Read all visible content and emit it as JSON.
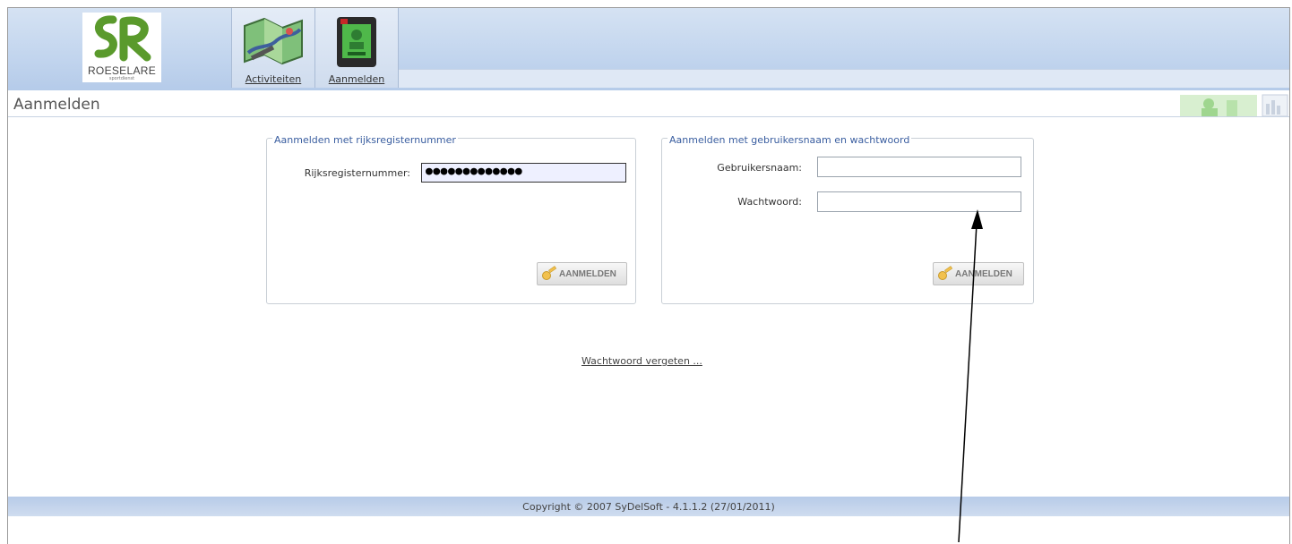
{
  "logo": {
    "text": "ROESELARE",
    "subtext": "sportdienst"
  },
  "nav": {
    "tabs": [
      {
        "label": "Activiteiten"
      },
      {
        "label": "Aanmelden"
      }
    ]
  },
  "page": {
    "title": "Aanmelden"
  },
  "panel_rrn": {
    "legend": "Aanmelden met rijksregisternummer",
    "label": "Rijksregisternummer:",
    "value": "●●●●●●●●●●●●●",
    "button": "AANMELDEN"
  },
  "panel_login": {
    "legend": "Aanmelden met gebruikersnaam en wachtwoord",
    "username_label": "Gebruikersnaam:",
    "username_value": "",
    "password_label": "Wachtwoord:",
    "password_value": "",
    "button": "AANMELDEN"
  },
  "forgot_link": "Wachtwoord vergeten ...",
  "footer": {
    "copyright": "Copyright © 2007 SyDelSoft - 4.1.1.2 (27/01/2011)"
  },
  "colors": {
    "header": "#c2d5ee",
    "legend": "#3a5ea0",
    "logo_green": "#5a9a2c"
  }
}
